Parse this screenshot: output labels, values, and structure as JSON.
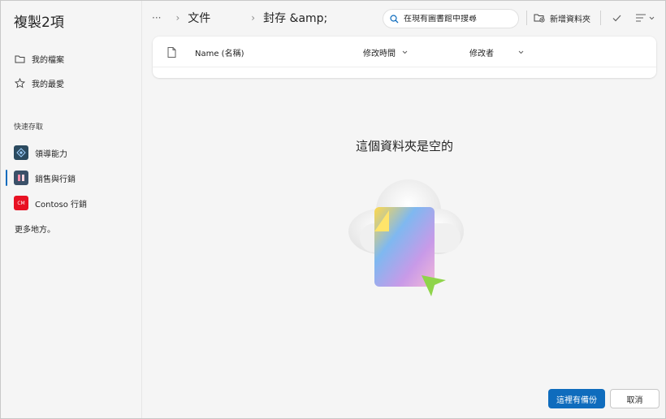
{
  "dialog": {
    "title": "複製2項"
  },
  "sidebar": {
    "items": [
      {
        "label": "我的檔案",
        "icon": "folder-icon"
      },
      {
        "label": "我的最愛",
        "icon": "star-icon"
      }
    ],
    "section_label": "快速存取",
    "sites": [
      {
        "label": "領導能力",
        "icon": "leadership-site-icon",
        "color": "#2b4a5f"
      },
      {
        "label": "銷售與行銷",
        "icon": "sales-site-icon",
        "color": "#3a5068",
        "selected": true
      },
      {
        "label": "Contoso 行銷",
        "icon": "contoso-site-icon",
        "color": "#e81123",
        "badge": "CM"
      }
    ],
    "more_label": "更多地方。"
  },
  "breadcrumb": {
    "overflow": "···",
    "items": [
      "文件",
      "封存 &amp;"
    ]
  },
  "search": {
    "placeholder": "在現有圖書館中搜尋"
  },
  "toolbar": {
    "new_folder_label": "新增資料夾"
  },
  "list": {
    "columns": [
      {
        "label": "Name (名稱)"
      },
      {
        "label": "修改時間",
        "sortable": true
      },
      {
        "label": "修改者",
        "sortable": true
      }
    ]
  },
  "empty_state": {
    "message": "這個資料夾是空的"
  },
  "footer": {
    "primary_label": "這裡有備份",
    "cancel_label": "取消"
  },
  "colors": {
    "accent": "#0f6cbd",
    "contoso_red": "#e81123"
  }
}
